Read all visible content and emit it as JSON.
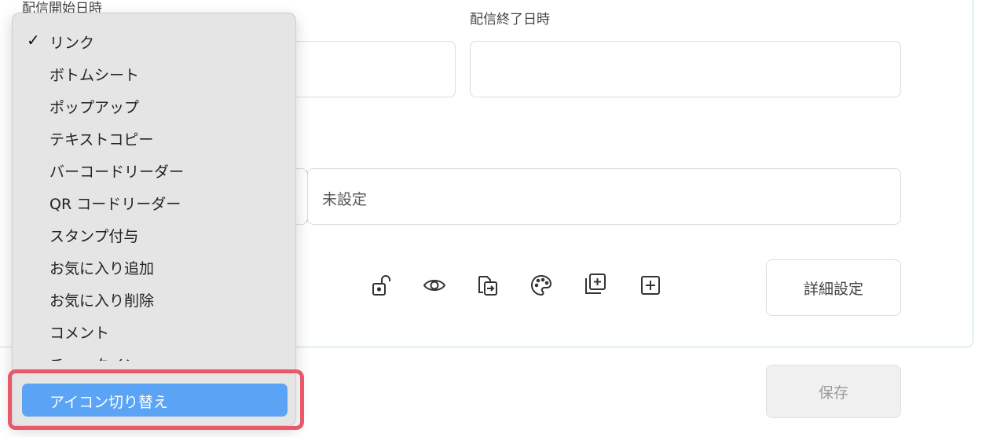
{
  "form": {
    "start_label": "配信開始日時",
    "end_label": "配信終了日時",
    "start_value": "",
    "end_value": "",
    "action_value": "未設定",
    "detail_button": "詳細設定",
    "save_button": "保存"
  },
  "toolbar_icons": [
    "unlock-icon",
    "eye-icon",
    "transfer-icon",
    "palette-icon",
    "duplicate-icon",
    "add-icon"
  ],
  "dropdown": {
    "items": [
      {
        "label": "リンク",
        "checked": true
      },
      {
        "label": "ボトムシート"
      },
      {
        "label": "ポップアップ"
      },
      {
        "label": "テキストコピー"
      },
      {
        "label": "バーコードリーダー"
      },
      {
        "label": "QR コードリーダー"
      },
      {
        "label": "スタンプ付与"
      },
      {
        "label": "お気に入り追加"
      },
      {
        "label": "お気に入り削除"
      },
      {
        "label": "コメント"
      },
      {
        "label": "チェックイン"
      },
      {
        "label": "アイコン切り替え",
        "selected": true
      }
    ],
    "check_mark": "✓"
  },
  "colors": {
    "accent": "#5aa3f5",
    "highlight": "#e8596b",
    "card_border": "#bfe0ea"
  }
}
